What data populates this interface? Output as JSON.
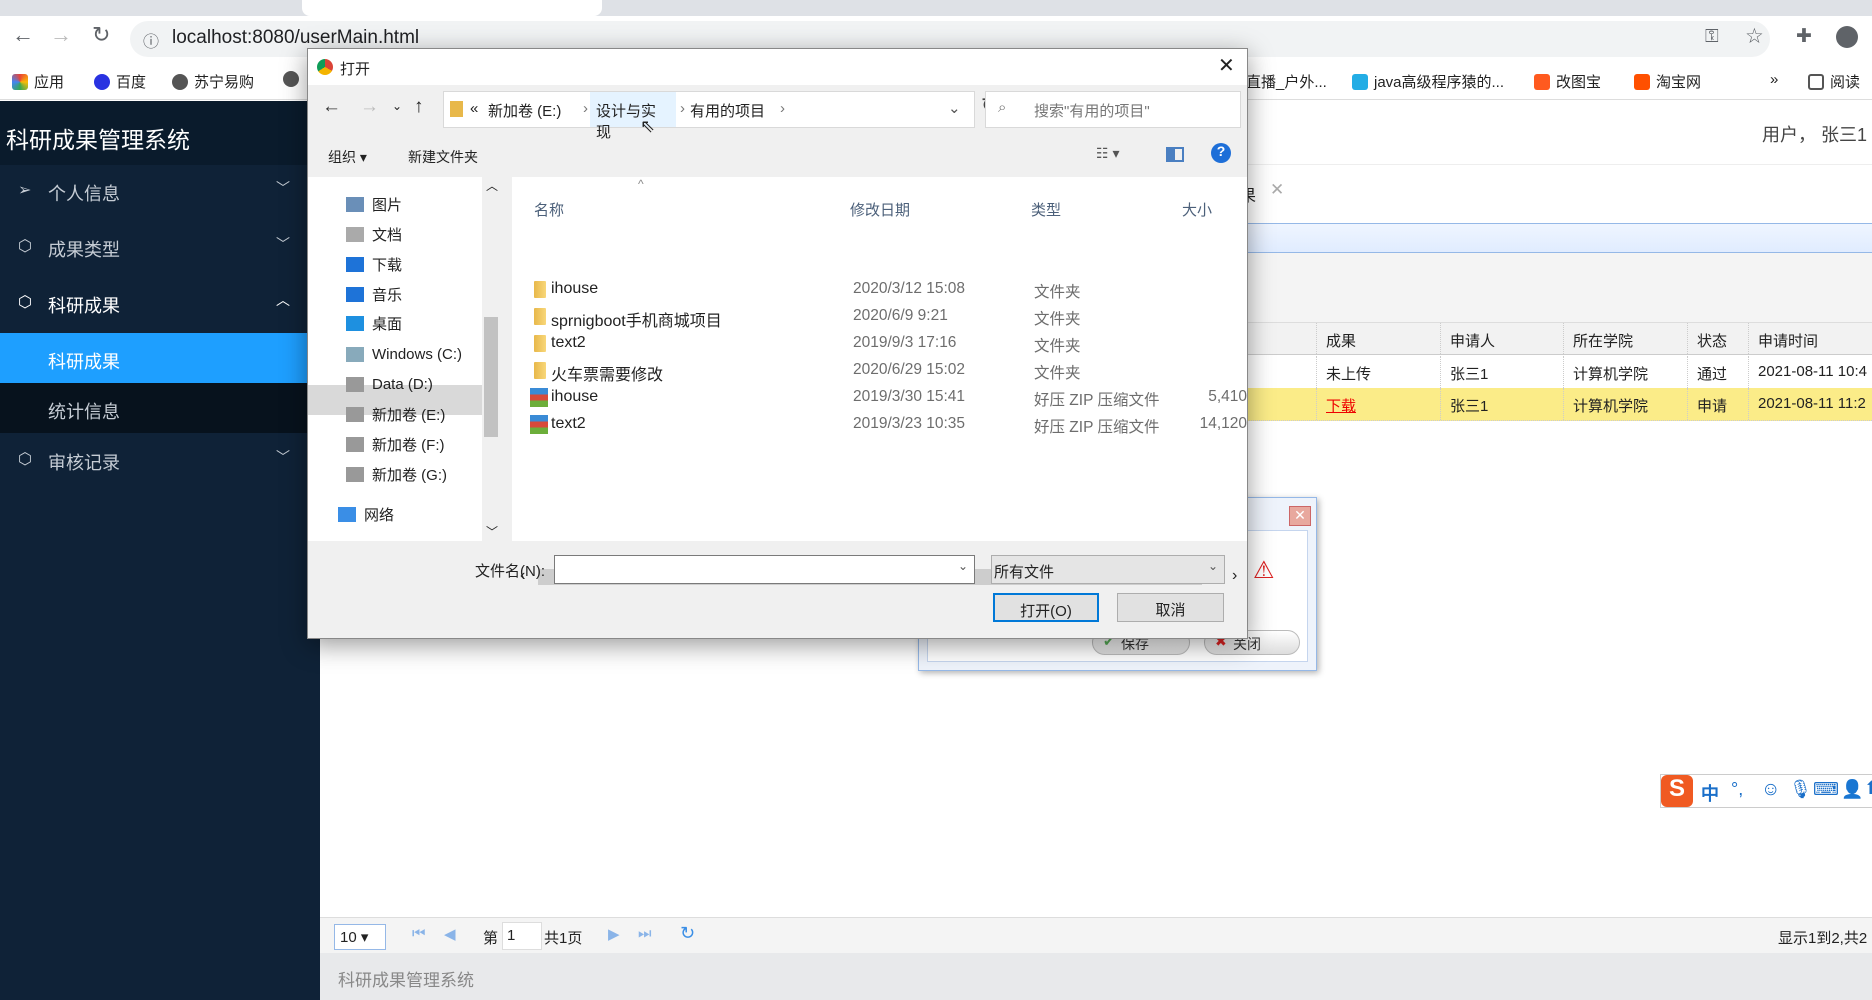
{
  "browser": {
    "url": "localhost:8080/userMain.html",
    "bookmarks": [
      "应用",
      "百度",
      "苏宁易购",
      "直播_户外...",
      "java高级程序猿的...",
      "改图宝",
      "淘宝网",
      "»",
      "阅读"
    ]
  },
  "app": {
    "title": "科研成果管理系统",
    "user": "用户， 张三1",
    "footer": "科研成果管理系统",
    "menu": [
      {
        "label": "个人信息",
        "icon": "send-icon"
      },
      {
        "label": "成果类型",
        "icon": "cube-icon"
      },
      {
        "label": "科研成果",
        "icon": "cube-icon",
        "expanded": true
      },
      {
        "label": "审核记录",
        "icon": "cube-icon"
      }
    ],
    "submenu": [
      {
        "label": "科研成果",
        "active": true
      },
      {
        "label": "统计信息"
      }
    ],
    "tab_label_partial": "果",
    "table": {
      "headers": [
        "成果",
        "申请人",
        "所在学院",
        "状态",
        "申请时间"
      ],
      "rows": [
        [
          "未上传",
          "张三1",
          "计算机学院",
          "通过",
          "2021-08-11 10:4"
        ],
        [
          "下载",
          "张三1",
          "计算机学院",
          "申请",
          "2021-08-11 11:2"
        ]
      ]
    },
    "pager": {
      "page_size": "10",
      "page_prefix": "第",
      "page": "1",
      "page_total": "共1页",
      "summary": "显示1到2,共2"
    }
  },
  "message_dialog": {
    "save": "保存",
    "close": "关闭"
  },
  "open_dialog": {
    "title": "打开",
    "breadcrumb": [
      "«",
      "新加卷 (E:)",
      "设计与实现",
      "有用的项目"
    ],
    "search_placeholder": "搜索\"有用的项目\"",
    "organize": "组织 ▾",
    "new_folder": "新建文件夹",
    "nav": [
      "图片",
      "文档",
      "下载",
      "音乐",
      "桌面",
      "Windows (C:)",
      "Data (D:)",
      "新加卷 (E:)",
      "新加卷 (F:)",
      "新加卷 (G:)",
      "网络"
    ],
    "columns": [
      "名称",
      "修改日期",
      "类型",
      "大小"
    ],
    "files": [
      {
        "name": "ihouse",
        "date": "2020/3/12 15:08",
        "type": "文件夹",
        "size": "",
        "kind": "folder"
      },
      {
        "name": "sprnigboot手机商城项目",
        "date": "2020/6/9 9:21",
        "type": "文件夹",
        "size": "",
        "kind": "folder"
      },
      {
        "name": "text2",
        "date": "2019/9/3 17:16",
        "type": "文件夹",
        "size": "",
        "kind": "folder"
      },
      {
        "name": "火车票需要修改",
        "date": "2020/6/29 15:02",
        "type": "文件夹",
        "size": "",
        "kind": "folder"
      },
      {
        "name": "ihouse",
        "date": "2019/3/30 15:41",
        "type": "好压 ZIP 压缩文件",
        "size": "5,410",
        "kind": "zip"
      },
      {
        "name": "text2",
        "date": "2019/3/23 10:35",
        "type": "好压 ZIP 压缩文件",
        "size": "14,120",
        "kind": "zip"
      }
    ],
    "filename_label": "文件名(N):",
    "filename_value": "",
    "filetype": "所有文件",
    "open": "打开(O)",
    "cancel": "取消"
  },
  "ime": {
    "label": "中"
  }
}
